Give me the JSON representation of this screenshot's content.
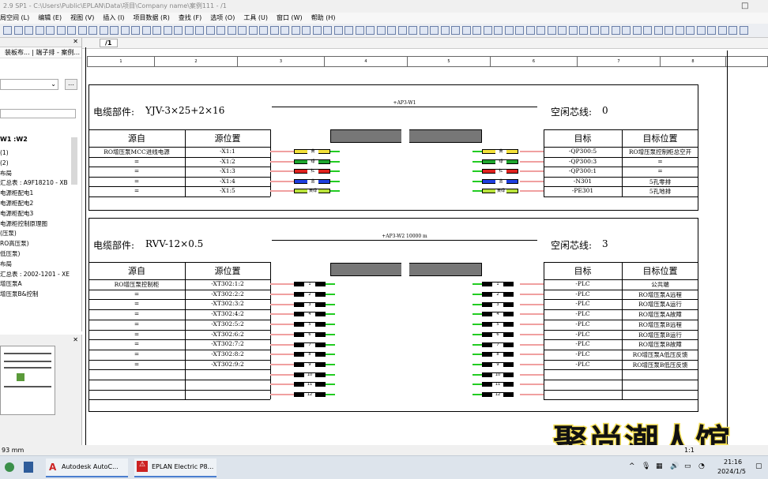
{
  "window": {
    "title": "2.9 SP1 - C:\\Users\\Public\\EPLAN\\Data\\项目\\Company name\\案例111 - /1"
  },
  "menu": [
    "局空间 (L)",
    "编辑 (E)",
    "视图 (V)",
    "插入 (I)",
    "项目数据 (R)",
    "查找 (F)",
    "选项 (O)",
    "工具 (U)",
    "窗口 (W)",
    "帮助 (H)"
  ],
  "left_panel": {
    "tabs": [
      "装板布...",
      "端子排 - 案例..."
    ],
    "tree_header": "W1 :W2",
    "items": [
      "(1)",
      "(2)",
      "布局",
      "汇总表 : A9F18210 - XB",
      "电源柜配电1",
      "电源柜配电2",
      "电源柜配电3",
      "电源柜控制原理图",
      "(压泵)",
      "RO高压泵)",
      "低压泵)",
      "布局",
      "汇总表 : 2002-1201 - XE",
      "增压泵A",
      "增压泵B&控制"
    ],
    "bottom_label": "93 mm"
  },
  "page_tab": "/1",
  "ruler": [
    "1",
    "2",
    "3",
    "4",
    "5",
    "6",
    "7",
    "8"
  ],
  "cable1": {
    "part_label": "电缆部件:",
    "part_value": "YJV-3×25+2×16",
    "spare_label": "空闲芯线:",
    "spare_value": "0",
    "cable_name": "+AP3-W1",
    "headers": {
      "src": "源自",
      "src_pos": "源位置",
      "tgt": "目标",
      "tgt_pos": "目标位置"
    },
    "rows": [
      {
        "src": "RO增压泵MCC进线电源",
        "pos": "-X1:1",
        "core": "黄",
        "color": "#f5e23a",
        "tgt": "-QP300:5",
        "tgt_pos": "RO增压泵控制柜总空开"
      },
      {
        "src": "=",
        "pos": "-X1:2",
        "core": "绿",
        "color": "#1ea62e",
        "tgt": "-QP300:3",
        "tgt_pos": "="
      },
      {
        "src": "=",
        "pos": "-X1:3",
        "core": "红",
        "color": "#e0221e",
        "tgt": "-QP300:1",
        "tgt_pos": "="
      },
      {
        "src": "=",
        "pos": "-X1:4",
        "core": "蓝",
        "color": "#1e3fe0",
        "tgt": "-N301",
        "tgt_pos": "5孔零排"
      },
      {
        "src": "=",
        "pos": "-X1:5",
        "core": "黄绿",
        "color": "#b8e23a",
        "tgt": "-PE301",
        "tgt_pos": "5孔地排"
      }
    ]
  },
  "cable2": {
    "part_label": "电缆部件:",
    "part_value": "RVV-12×0.5",
    "spare_label": "空闲芯线:",
    "spare_value": "3",
    "cable_name": "+AP3-W2  10000 m",
    "headers": {
      "src": "源自",
      "src_pos": "源位置",
      "tgt": "目标",
      "tgt_pos": "目标位置"
    },
    "rows": [
      {
        "src": "RO增压泵控制柜",
        "pos": "-XT302:1:2",
        "core": "1",
        "tgt": "-PLC",
        "tgt_pos": "公共端"
      },
      {
        "src": "=",
        "pos": "-XT302:2:2",
        "core": "2",
        "tgt": "-PLC",
        "tgt_pos": "RO增压泵A远程"
      },
      {
        "src": "=",
        "pos": "-XT302:3:2",
        "core": "3",
        "tgt": "-PLC",
        "tgt_pos": "RO增压泵A运行"
      },
      {
        "src": "=",
        "pos": "-XT302:4:2",
        "core": "4",
        "tgt": "-PLC",
        "tgt_pos": "RO增压泵A故障"
      },
      {
        "src": "=",
        "pos": "-XT302:5:2",
        "core": "5",
        "tgt": "-PLC",
        "tgt_pos": "RO增压泵B远程"
      },
      {
        "src": "=",
        "pos": "-XT302:6:2",
        "core": "6",
        "tgt": "-PLC",
        "tgt_pos": "RO增压泵B运行"
      },
      {
        "src": "=",
        "pos": "-XT302:7:2",
        "core": "7",
        "tgt": "-PLC",
        "tgt_pos": "RO增压泵B故障"
      },
      {
        "src": "=",
        "pos": "-XT302:8:2",
        "core": "8",
        "tgt": "-PLC",
        "tgt_pos": "RO增压泵A低压反馈"
      },
      {
        "src": "=",
        "pos": "-XT302:9:2",
        "core": "9",
        "tgt": "-PLC",
        "tgt_pos": "RO增压泵B低压反馈"
      },
      {
        "src": "",
        "pos": "",
        "core": "10",
        "tgt": "",
        "tgt_pos": ""
      },
      {
        "src": "",
        "pos": "",
        "core": "11",
        "tgt": "",
        "tgt_pos": ""
      },
      {
        "src": "",
        "pos": "",
        "core": "12",
        "tgt": "",
        "tgt_pos": ""
      }
    ]
  },
  "taskbar": {
    "apps": [
      "Autodesk AutoC...",
      "EPLAN Electric P8..."
    ],
    "time": "21:16",
    "date": "2024/1/5",
    "status_partial": "1:1"
  },
  "watermark": "聚尚潮人馆",
  "colors": {
    "wire_stripe": "#f0a0a0",
    "core_black": "#000000",
    "core_tag_bg": "#ffffff"
  }
}
